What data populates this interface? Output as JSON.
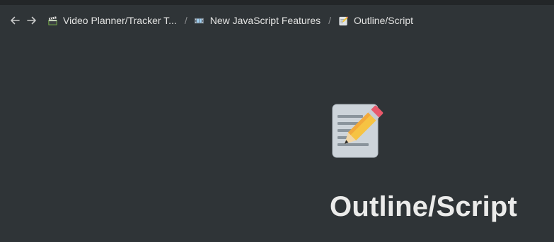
{
  "nav": {
    "back_icon": "arrow-left-icon",
    "forward_icon": "arrow-right-icon"
  },
  "breadcrumbs": [
    {
      "icon": "clapper-board-icon",
      "label": "Video Planner/Tracker T..."
    },
    {
      "icon": "film-strip-icon",
      "label": "New JavaScript Features"
    },
    {
      "icon": "memo-icon",
      "label": "Outline/Script"
    }
  ],
  "separator": "/",
  "page": {
    "icon": "memo-icon",
    "title": "Outline/Script"
  },
  "colors": {
    "background": "#2f3437",
    "text": "#ebebea",
    "separator": "#8b8d8f"
  }
}
